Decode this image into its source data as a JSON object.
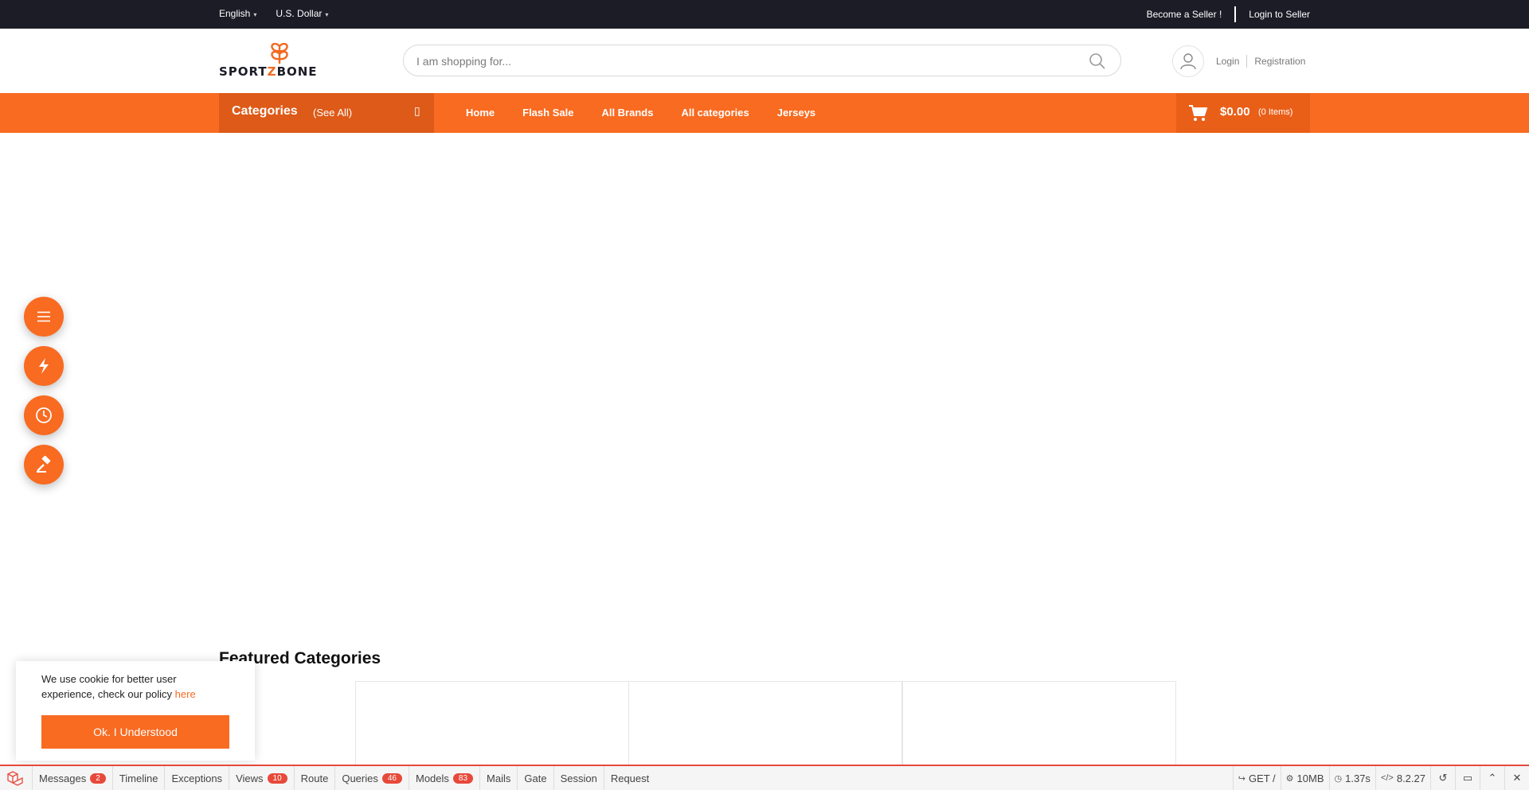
{
  "topbar": {
    "language": "English",
    "currency": "U.S. Dollar",
    "become_seller": "Become a Seller !",
    "login_seller": "Login to Seller"
  },
  "header": {
    "logo_text_a": "SPORT",
    "logo_text_z": "Z",
    "logo_text_b": "BONE",
    "search_placeholder": "I am shopping for...",
    "login": "Login",
    "registration": "Registration"
  },
  "navbar": {
    "categories_title": "Categories",
    "see_all": "(See All)",
    "links": [
      "Home",
      "Flash Sale",
      "All Brands",
      "All categories",
      "Jerseys"
    ],
    "cart_amount": "$0.00",
    "cart_items": "(0 Items)"
  },
  "floating_buttons": [
    "menu-icon",
    "flash-icon",
    "clock-icon",
    "gavel-icon"
  ],
  "featured": {
    "title": "Featured Categories"
  },
  "cookie": {
    "message": "We use cookie for better user experience, check our policy ",
    "link": "here",
    "button": "Ok. I Understood"
  },
  "debugbar": {
    "tabs": [
      {
        "label": "Messages",
        "badge": "2"
      },
      {
        "label": "Timeline",
        "badge": null
      },
      {
        "label": "Exceptions",
        "badge": null
      },
      {
        "label": "Views",
        "badge": "10"
      },
      {
        "label": "Route",
        "badge": null
      },
      {
        "label": "Queries",
        "badge": "46"
      },
      {
        "label": "Models",
        "badge": "83"
      },
      {
        "label": "Mails",
        "badge": null
      },
      {
        "label": "Gate",
        "badge": null
      },
      {
        "label": "Session",
        "badge": null
      },
      {
        "label": "Request",
        "badge": null
      }
    ],
    "method": "GET /",
    "memory": "10MB",
    "time": "1.37s",
    "php_version": "8.2.27"
  },
  "colors": {
    "accent": "#f86b21",
    "topbar": "#1b1c26",
    "debug_red": "#e7493a"
  }
}
